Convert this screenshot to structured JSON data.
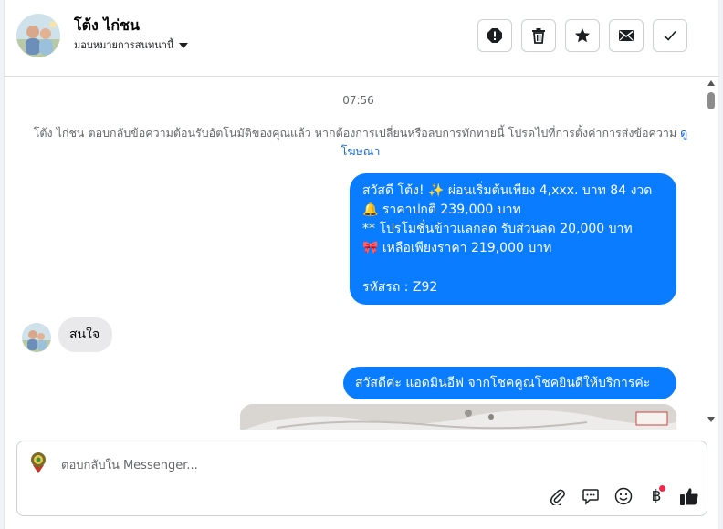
{
  "header": {
    "contact_name": "โต้ง ไก่ชน",
    "assign_label": "มอบหมายการสนทนานี้"
  },
  "messages": {
    "timestamp": "07:56",
    "notice_text": "โต้ง ไก่ชน ตอบกลับข้อความต้อนรับอัตโนมัติของคุณแล้ว หากต้องการเปลี่ยนหรือลบการทักทายนี้ โปรดไปที่การตั้งค่าการส่งข้อความ",
    "notice_link": "ดูโฆษณา",
    "outgoing_1": {
      "line1": "สวัสดี โต้ง! ✨  ผ่อนเริ่มต้นเพียง 4,xxx. บาท 84 งวด",
      "line2": "🔔 ราคาปกติ 239,000 บาท",
      "line3": "** โปรโมชั่นข้าวแลกลด รับส่วนลด 20,000 บาท",
      "line4": "🎀  เหลือเพียงราคา 219,000 บาท",
      "line5": "รหัสรถ : Z92"
    },
    "incoming_1": "สนใจ",
    "outgoing_2": "สวัสดีค่ะ แอดมินอีฟ จากโชคคูณโชคยินดีให้บริการค่ะ"
  },
  "composer": {
    "placeholder": "ตอบกลับใน Messenger...",
    "currency_symbol": "฿"
  },
  "colors": {
    "outgoing_bubble": "#0a7cff",
    "incoming_bubble": "#e9e9eb",
    "link": "#1766d6",
    "notification_dot": "#f02849"
  },
  "icons": [
    "alert-icon",
    "trash-icon",
    "star-icon",
    "mail-icon",
    "check-icon",
    "chevron-down-icon",
    "paperclip-icon",
    "chat-bubble-icon",
    "emoji-icon",
    "baht-icon",
    "thumbs-up-icon"
  ]
}
